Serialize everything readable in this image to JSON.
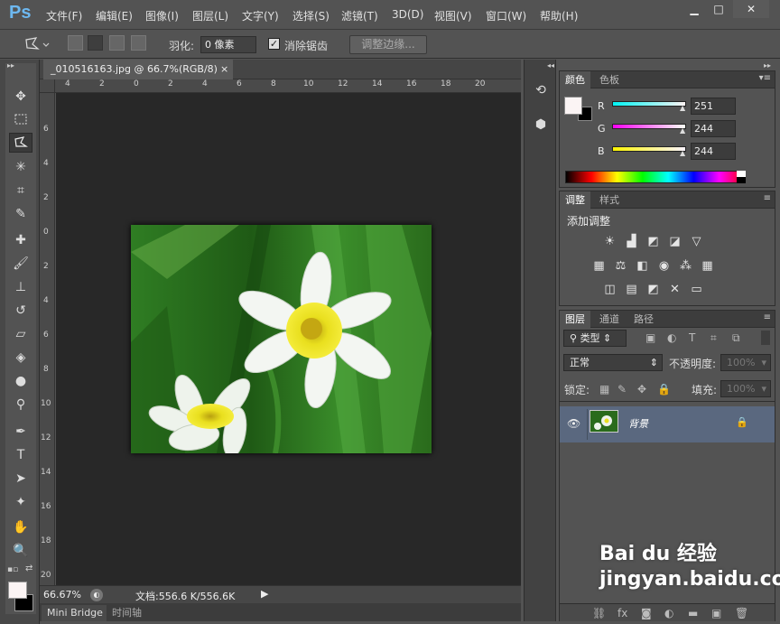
{
  "app": {
    "logo": "Ps"
  },
  "menu": [
    "文件(F)",
    "编辑(E)",
    "图像(I)",
    "图层(L)",
    "文字(Y)",
    "选择(S)",
    "滤镜(T)",
    "3D(D)",
    "视图(V)",
    "窗口(W)",
    "帮助(H)"
  ],
  "window_controls": {
    "minimize": "▁",
    "maximize": "□",
    "close": "✕"
  },
  "options": {
    "feather_label": "羽化:",
    "feather_value": "0 像素",
    "antialias_label": "消除锯齿",
    "antialias_checked": true,
    "refine_edge": "调整边缘..."
  },
  "document": {
    "tab_title": "_010516163.jpg @ 66.7%(RGB/8)",
    "close": "×",
    "ruler_top": [
      "4",
      "2",
      "0",
      "2",
      "4",
      "6",
      "8",
      "10",
      "12",
      "14",
      "16",
      "18",
      "20"
    ],
    "ruler_left": [
      "6",
      "4",
      "2",
      "0",
      "2",
      "4",
      "6",
      "8",
      "10",
      "12",
      "14",
      "16",
      "18",
      "20"
    ],
    "zoom": "66.67%",
    "doc_info": "文档:556.6 K/556.6K"
  },
  "bottom_tabs": [
    "Mini Bridge",
    "时间轴"
  ],
  "color_panel": {
    "tabs": [
      "颜色",
      "色板"
    ],
    "r_label": "R",
    "r": "251",
    "g_label": "G",
    "g": "244",
    "b_label": "B",
    "b": "244",
    "fg_color": "#fbf4f4",
    "bg_color": "#000000"
  },
  "adjust_panel": {
    "tabs": [
      "调整",
      "样式"
    ],
    "title": "添加调整"
  },
  "layers_panel": {
    "tabs": [
      "图层",
      "通道",
      "路径"
    ],
    "filter": "类型",
    "blend_mode": "正常",
    "opacity_label": "不透明度:",
    "opacity_value": "100%",
    "lock_label": "锁定:",
    "fill_label": "填充:",
    "fill_value": "100%",
    "layer_name": "背景"
  },
  "watermark": "Bai du 经验 jingyan.baidu.com"
}
